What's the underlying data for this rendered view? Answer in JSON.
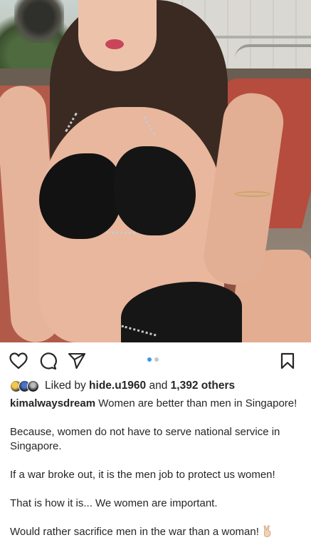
{
  "post": {
    "actions": {
      "like_icon": "heart-outline-icon",
      "comment_icon": "comment-bubble-icon",
      "share_icon": "paper-plane-icon",
      "save_icon": "bookmark-icon"
    },
    "carousel": {
      "total": 2,
      "active": 1,
      "active_color": "#3897f0",
      "inactive_color": "#c7c7c7"
    },
    "likes": {
      "prefix": "Liked by",
      "user": "hide.u1960",
      "joiner": "and",
      "others": "1,392 others"
    },
    "caption": {
      "username": "kimalwaysdream",
      "first_line": "Women are better than men in Singapore!",
      "paragraphs": [
        "Because, women do not have to serve national service in Singapore.",
        "If a war broke out, it is the men job to protect us women!",
        "That is how it is... We women are important."
      ],
      "last_line": "Would rather sacrifice men in the war than a woman!",
      "emoji_icon": "victory-hand-icon"
    }
  }
}
